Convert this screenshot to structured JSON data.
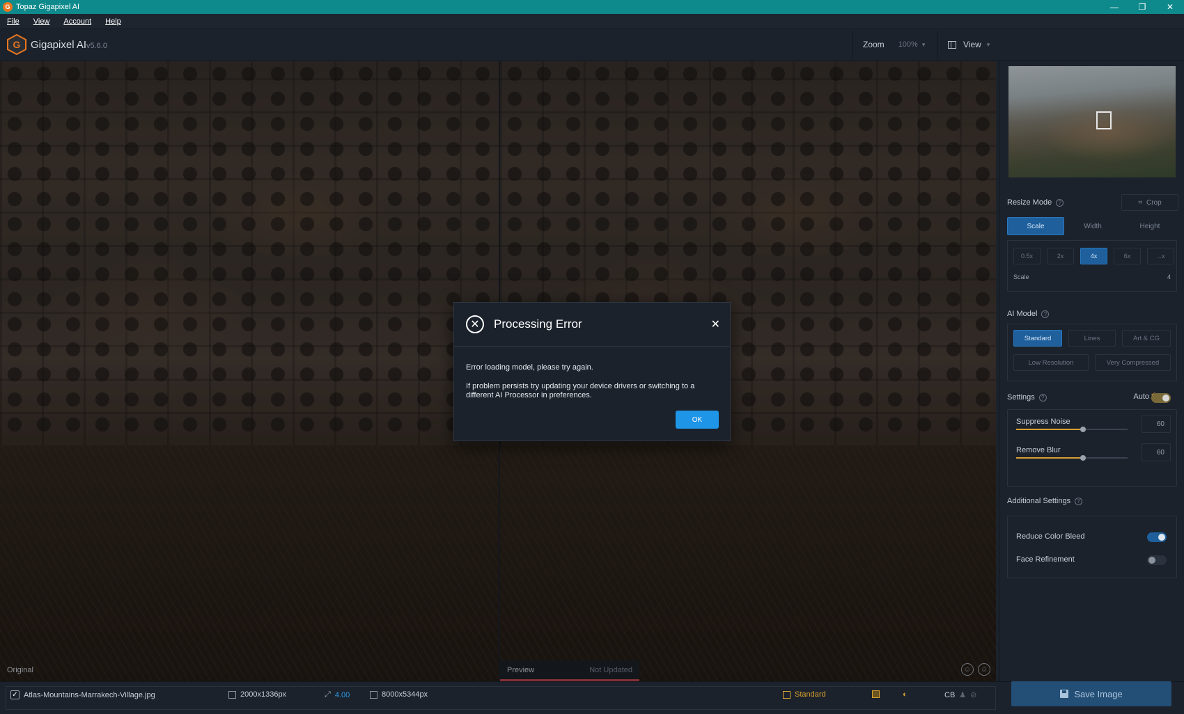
{
  "window": {
    "title": "Topaz Gigapixel AI",
    "minimize": "—",
    "maximize": "❐",
    "close": "✕"
  },
  "menu": [
    "File",
    "View",
    "Account",
    "Help"
  ],
  "header": {
    "app_name": "Gigapixel AI",
    "version": "v5.6.0",
    "zoom_label": "Zoom",
    "zoom_value": "100%",
    "view_label": "View"
  },
  "panes": {
    "left_label": "Original",
    "preview_label": "Preview",
    "preview_status": "Not Updated"
  },
  "dialog": {
    "title": "Processing Error",
    "line1": "Error loading model, please try again.",
    "line2": "If problem persists try updating your device drivers or switching to a different AI Processor in preferences.",
    "ok": "OK"
  },
  "sidebar": {
    "resize_mode": "Resize Mode",
    "crop": "Crop",
    "resize_tabs": [
      "Scale",
      "Width",
      "Height"
    ],
    "scale_options": [
      "0.5x",
      "2x",
      "4x",
      "6x",
      "...x"
    ],
    "scale_label": "Scale",
    "scale_value": "4",
    "ai_model": "AI Model",
    "models_row1": [
      "Standard",
      "Lines",
      "Art & CG"
    ],
    "models_row2": [
      "Low Resolution",
      "Very Compressed"
    ],
    "settings": "Settings",
    "auto": "Auto",
    "suppress_noise": "Suppress Noise",
    "suppress_noise_value": "60",
    "remove_blur": "Remove Blur",
    "remove_blur_value": "60",
    "additional": "Additional Settings",
    "reduce_color_bleed": "Reduce Color Bleed",
    "face_refinement": "Face Refinement"
  },
  "bottom": {
    "filename": "Atlas-Mountains-Marrakech-Village.jpg",
    "input_size": "2000x1336px",
    "scale": "4.00",
    "output_size": "8000x5344px",
    "model": "Standard",
    "cb": "CB",
    "save": "Save Image"
  }
}
